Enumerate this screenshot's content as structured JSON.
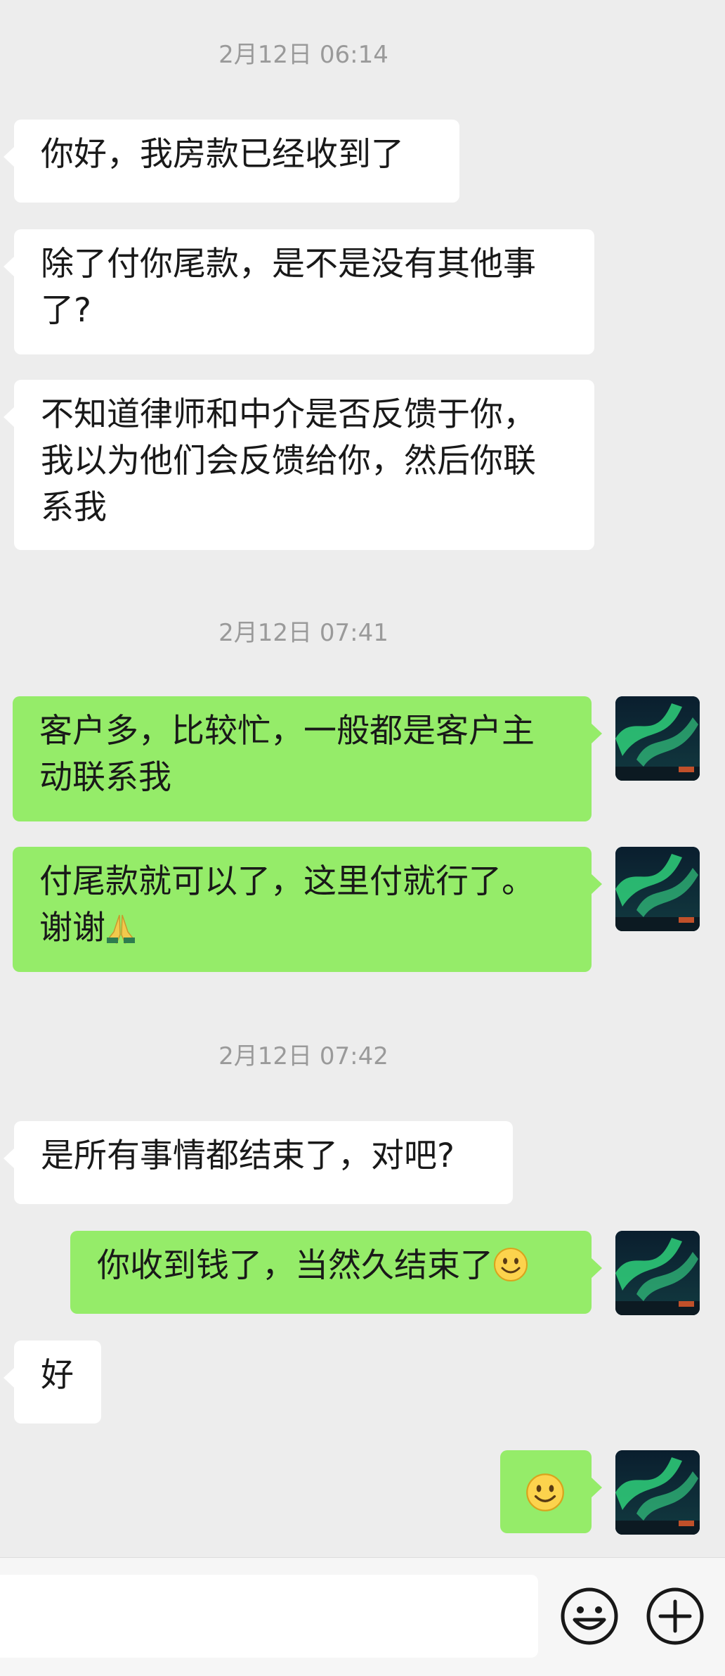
{
  "timestamps": [
    "2月12日 06:14",
    "2月12日 07:41",
    "2月12日 07:42"
  ],
  "messages": [
    {
      "side": "in",
      "text": "你好，我房款已经收到了"
    },
    {
      "side": "in",
      "text": "除了付你尾款，是不是没有其他事\n了?"
    },
    {
      "side": "in",
      "text": "不知道律师和中介是否反馈于你，\n我以为他们会反馈给你，然后你联\n系我"
    },
    {
      "side": "out",
      "text": "客户多，比较忙，一般都是客户主\n动联系我"
    },
    {
      "side": "out",
      "text": "付尾款就可以了，这里付就行了。\n谢谢",
      "emoji": "pray-emoji"
    },
    {
      "side": "in",
      "text": "是所有事情都结束了，对吧?"
    },
    {
      "side": "out",
      "text": "你收到钱了，当然久结束了",
      "emoji": "smile-emoji"
    },
    {
      "side": "in",
      "text": "好"
    },
    {
      "side": "out",
      "text": "",
      "emoji": "smile-emoji"
    }
  ],
  "input_bar": {
    "value": "",
    "icons": [
      "emoji-icon",
      "plus-icon"
    ]
  },
  "colors": {
    "background": "#ededed",
    "incoming_bubble": "#ffffff",
    "outgoing_bubble": "#95ec69"
  }
}
